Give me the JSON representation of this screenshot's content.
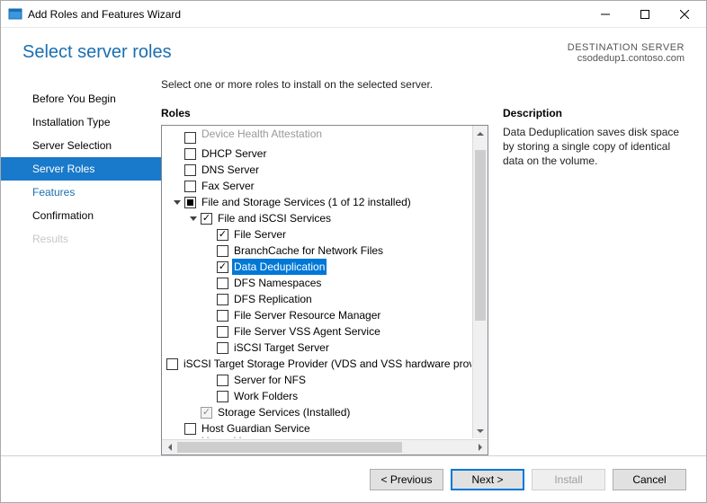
{
  "window": {
    "title": "Add Roles and Features Wizard"
  },
  "header": {
    "title": "Select server roles",
    "destination_label": "DESTINATION SERVER",
    "destination_value": "csodedup1.contoso.com"
  },
  "nav": {
    "items": [
      {
        "label": "Before You Begin",
        "state": "normal"
      },
      {
        "label": "Installation Type",
        "state": "normal"
      },
      {
        "label": "Server Selection",
        "state": "normal"
      },
      {
        "label": "Server Roles",
        "state": "active"
      },
      {
        "label": "Features",
        "state": "link"
      },
      {
        "label": "Confirmation",
        "state": "normal"
      },
      {
        "label": "Results",
        "state": "disabled"
      }
    ]
  },
  "main": {
    "instruction": "Select one or more roles to install on the selected server.",
    "roles_label": "Roles",
    "description_label": "Description",
    "description_text": "Data Deduplication saves disk space by storing a single copy of identical data on the volume."
  },
  "roles": [
    {
      "level": 1,
      "checkbox": "unchecked",
      "label": "Device Health Attestation",
      "display": "cut"
    },
    {
      "level": 1,
      "checkbox": "unchecked",
      "label": "DHCP Server"
    },
    {
      "level": 1,
      "checkbox": "unchecked",
      "label": "DNS Server"
    },
    {
      "level": 1,
      "checkbox": "unchecked",
      "label": "Fax Server"
    },
    {
      "level": 1,
      "expander": "open",
      "checkbox": "mixed",
      "label": "File and Storage Services (1 of 12 installed)"
    },
    {
      "level": 2,
      "expander": "open",
      "checkbox": "checked",
      "label": "File and iSCSI Services"
    },
    {
      "level": 3,
      "checkbox": "checked",
      "label": "File Server"
    },
    {
      "level": 3,
      "checkbox": "unchecked",
      "label": "BranchCache for Network Files"
    },
    {
      "level": 3,
      "checkbox": "checked",
      "label": "Data Deduplication",
      "selected": true
    },
    {
      "level": 3,
      "checkbox": "unchecked",
      "label": "DFS Namespaces"
    },
    {
      "level": 3,
      "checkbox": "unchecked",
      "label": "DFS Replication"
    },
    {
      "level": 3,
      "checkbox": "unchecked",
      "label": "File Server Resource Manager"
    },
    {
      "level": 3,
      "checkbox": "unchecked",
      "label": "File Server VSS Agent Service"
    },
    {
      "level": 3,
      "checkbox": "unchecked",
      "label": "iSCSI Target Server"
    },
    {
      "level": 3,
      "checkbox": "unchecked",
      "label": "iSCSI Target Storage Provider (VDS and VSS hardware providers)"
    },
    {
      "level": 3,
      "checkbox": "unchecked",
      "label": "Server for NFS"
    },
    {
      "level": 3,
      "checkbox": "unchecked",
      "label": "Work Folders"
    },
    {
      "level": 2,
      "checkbox": "checked-disabled",
      "label": "Storage Services (Installed)"
    },
    {
      "level": 1,
      "checkbox": "unchecked",
      "label": "Host Guardian Service"
    },
    {
      "level": 1,
      "checkbox": "unchecked",
      "label": "Hyper-V",
      "display": "cut"
    }
  ],
  "footer": {
    "previous": "< Previous",
    "next": "Next >",
    "install": "Install",
    "cancel": "Cancel"
  }
}
